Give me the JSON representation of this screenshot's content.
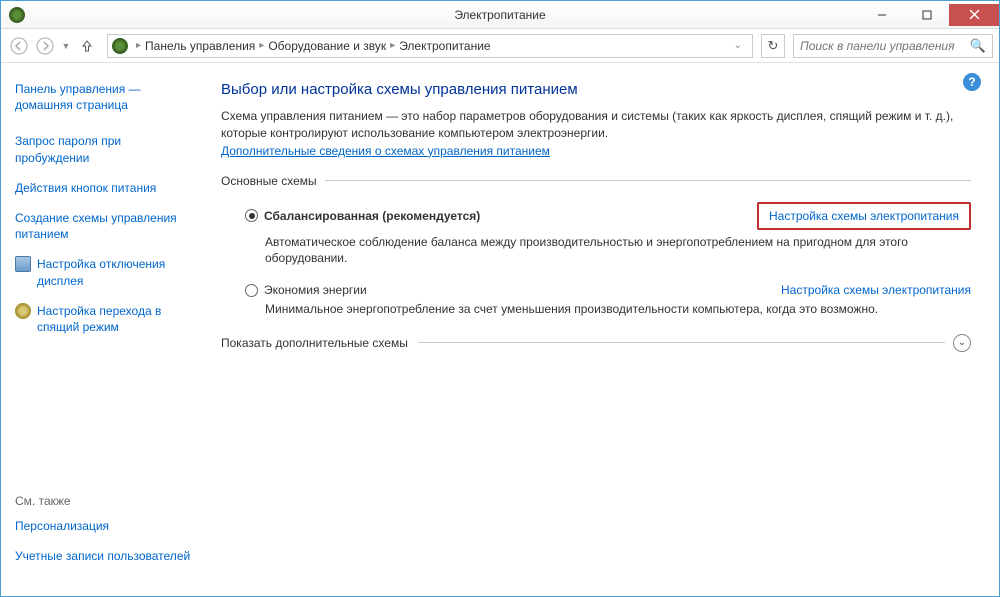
{
  "window": {
    "title": "Электропитание"
  },
  "breadcrumb": {
    "items": [
      "Панель управления",
      "Оборудование и звук",
      "Электропитание"
    ]
  },
  "search": {
    "placeholder": "Поиск в панели управления"
  },
  "sidebar": {
    "home": "Панель управления — домашняя страница",
    "links": [
      "Запрос пароля при пробуждении",
      "Действия кнопок питания",
      "Создание схемы управления питанием"
    ],
    "icon_links": [
      {
        "label": "Настройка отключения дисплея"
      },
      {
        "label": "Настройка перехода в спящий режим"
      }
    ],
    "see_also": "См. также",
    "bottom": [
      "Персонализация",
      "Учетные записи пользователей"
    ]
  },
  "main": {
    "title": "Выбор или настройка схемы управления питанием",
    "desc": "Схема управления питанием — это набор параметров оборудования и системы (таких как яркость дисплея, спящий режим и т. д.), которые контролируют использование компьютером электроэнергии.",
    "more_link": "Дополнительные сведения о схемах управления питанием",
    "section_basic": "Основные схемы",
    "plans": [
      {
        "name": "Сбалансированная (рекомендуется)",
        "desc": "Автоматическое соблюдение баланса между производительностью и энергопотреблением на пригодном для этого оборудовании.",
        "settings_link": "Настройка схемы электропитания",
        "checked": true,
        "highlighted": true
      },
      {
        "name": "Экономия энергии",
        "desc": "Минимальное энергопотребление за счет уменьшения производительности компьютера, когда это возможно.",
        "settings_link": "Настройка схемы электропитания",
        "checked": false,
        "highlighted": false
      }
    ],
    "expand_label": "Показать дополнительные схемы"
  }
}
